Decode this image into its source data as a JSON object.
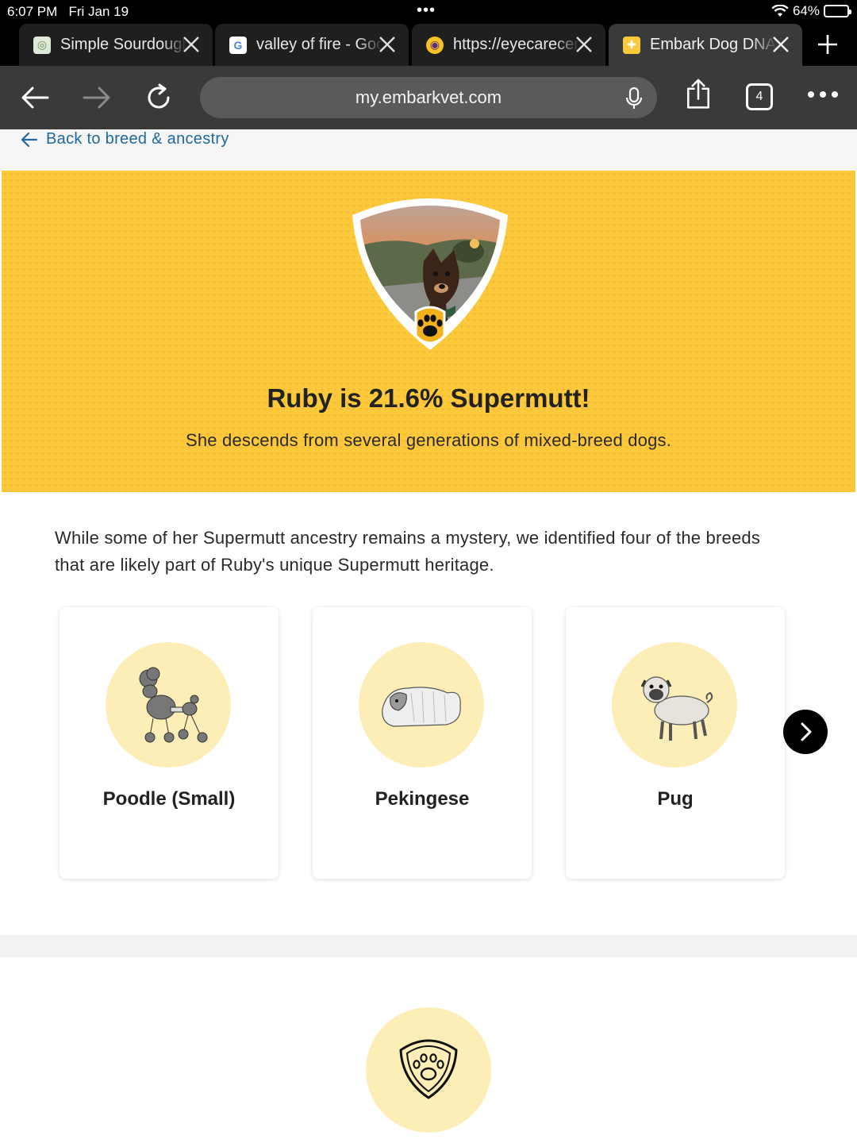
{
  "status_bar": {
    "time": "6:07 PM",
    "date": "Fri Jan 19",
    "battery": "64%",
    "battery_level": 0.64
  },
  "tabs": [
    {
      "title": "Simple Sourdough",
      "icon": "sourdough-favicon"
    },
    {
      "title": "valley of fire - Google",
      "icon": "google-favicon"
    },
    {
      "title": "https://eyecarecenter",
      "icon": "eyecare-favicon"
    },
    {
      "title": "Embark Dog DNA",
      "icon": "embark-favicon",
      "active": true
    }
  ],
  "toolbar": {
    "url": "my.embarkvet.com",
    "tab_count": "4"
  },
  "page": {
    "back_link": "Back to breed & ancestry",
    "hero": {
      "title": "Ruby is 21.6% Supermutt!",
      "subtitle": "She descends from several generations of mixed-breed dogs."
    },
    "intro": "While some of her Supermutt ancestry remains a mystery, we identified four of the breeds that are likely part of Ruby's unique Supermutt heritage.",
    "breeds": [
      {
        "name": "Poodle (Small)",
        "icon": "poodle-illustration"
      },
      {
        "name": "Pekingese",
        "icon": "pekingese-illustration"
      },
      {
        "name": "Pug",
        "icon": "pug-illustration"
      }
    ]
  },
  "colors": {
    "hero_yellow": "#fcc93a",
    "circle_cream": "#fdeeb7",
    "link_blue": "#1e6a9a"
  }
}
